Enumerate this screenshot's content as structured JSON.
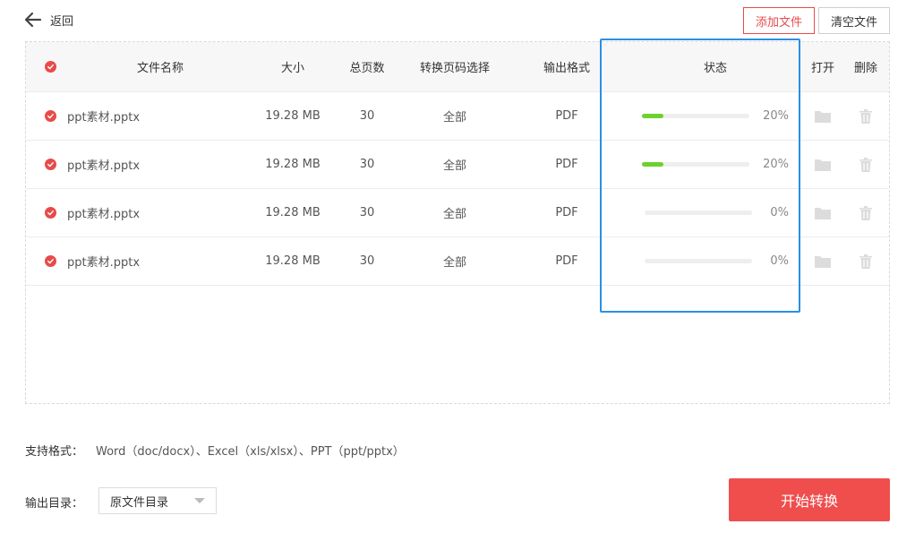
{
  "header": {
    "back_label": "返回",
    "add_file_label": "添加文件",
    "clear_files_label": "清空文件"
  },
  "table": {
    "columns": {
      "name": "文件名称",
      "size": "大小",
      "pages": "总页数",
      "page_range": "转换页码选择",
      "format": "输出格式",
      "status": "状态",
      "open": "打开",
      "delete": "删除"
    },
    "rows": [
      {
        "name": "ppt素材.pptx",
        "size": "19.28 MB",
        "pages": "30",
        "range": "全部",
        "format": "PDF",
        "progress": 20,
        "progress_label": "20%"
      },
      {
        "name": "ppt素材.pptx",
        "size": "19.28 MB",
        "pages": "30",
        "range": "全部",
        "format": "PDF",
        "progress": 20,
        "progress_label": "20%"
      },
      {
        "name": "ppt素材.pptx",
        "size": "19.28 MB",
        "pages": "30",
        "range": "全部",
        "format": "PDF",
        "progress": 0,
        "progress_label": "0%"
      },
      {
        "name": "ppt素材.pptx",
        "size": "19.28 MB",
        "pages": "30",
        "range": "全部",
        "format": "PDF",
        "progress": 0,
        "progress_label": "0%"
      }
    ]
  },
  "footer": {
    "support_label": "支持格式：",
    "support_value": "Word（doc/docx）、Excel（xls/xlsx）、PPT（ppt/pptx）",
    "output_label": "输出目录：",
    "output_selected": "原文件目录",
    "start_label": "开始转换"
  },
  "colors": {
    "accent": "#f04d4d",
    "progress": "#6cd22e",
    "highlight": "#2b8fe6"
  },
  "icons": {
    "back": "arrow-left-icon",
    "check": "check-circle-icon",
    "open": "folder-icon",
    "delete": "trash-icon"
  }
}
